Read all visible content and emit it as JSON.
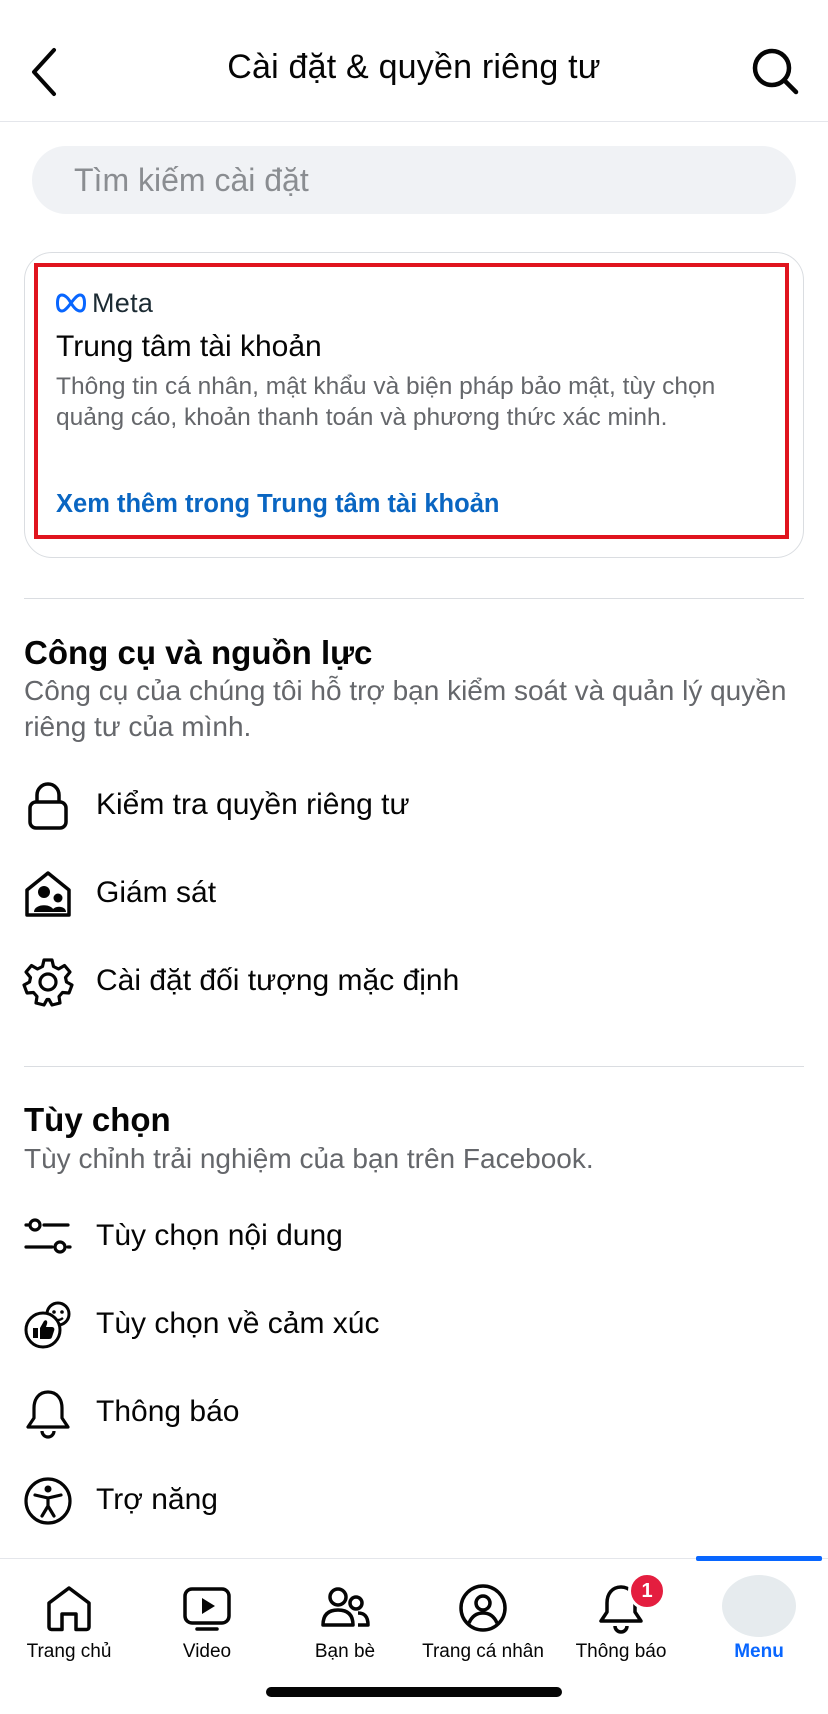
{
  "header": {
    "title": "Cài đặt & quyền riêng tư"
  },
  "search": {
    "placeholder": "Tìm kiếm cài đặt"
  },
  "account_center": {
    "brand": "Meta",
    "title": "Trung tâm tài khoản",
    "description": "Thông tin cá nhân, mật khẩu và biện pháp bảo mật, tùy chọn quảng cáo, khoản thanh toán và phương thức xác minh.",
    "link": "Xem thêm trong Trung tâm tài khoản",
    "highlight_color": "#e0141e"
  },
  "tools_section": {
    "title": "Công cụ và nguồn lực",
    "description": "Công cụ của chúng tôi hỗ trợ bạn kiểm soát và quản lý quyền riêng tư của mình.",
    "items": [
      {
        "label": "Kiểm tra quyền riêng tư",
        "icon": "lock-icon"
      },
      {
        "label": "Giám sát",
        "icon": "family-house-icon"
      },
      {
        "label": "Cài đặt đối tượng mặc định",
        "icon": "gear-icon"
      }
    ]
  },
  "preferences_section": {
    "title": "Tùy chọn",
    "description": "Tùy chỉnh trải nghiệm của bạn trên Facebook.",
    "items": [
      {
        "label": "Tùy chọn nội dung",
        "icon": "sliders-icon"
      },
      {
        "label": "Tùy chọn về cảm xúc",
        "icon": "reactions-icon"
      },
      {
        "label": "Thông báo",
        "icon": "bell-icon"
      },
      {
        "label": "Trợ năng",
        "icon": "accessibility-icon"
      }
    ]
  },
  "bottom_nav": {
    "items": [
      {
        "label": "Trang chủ",
        "icon": "home-icon"
      },
      {
        "label": "Video",
        "icon": "video-icon"
      },
      {
        "label": "Bạn bè",
        "icon": "friends-icon"
      },
      {
        "label": "Trang cá nhân",
        "icon": "profile-icon"
      },
      {
        "label": "Thông báo",
        "icon": "bell-icon",
        "badge": "1"
      },
      {
        "label": "Menu",
        "icon": "avatar",
        "active": true
      }
    ],
    "active_color": "#0866ff",
    "badge_color": "#e41e3f"
  }
}
